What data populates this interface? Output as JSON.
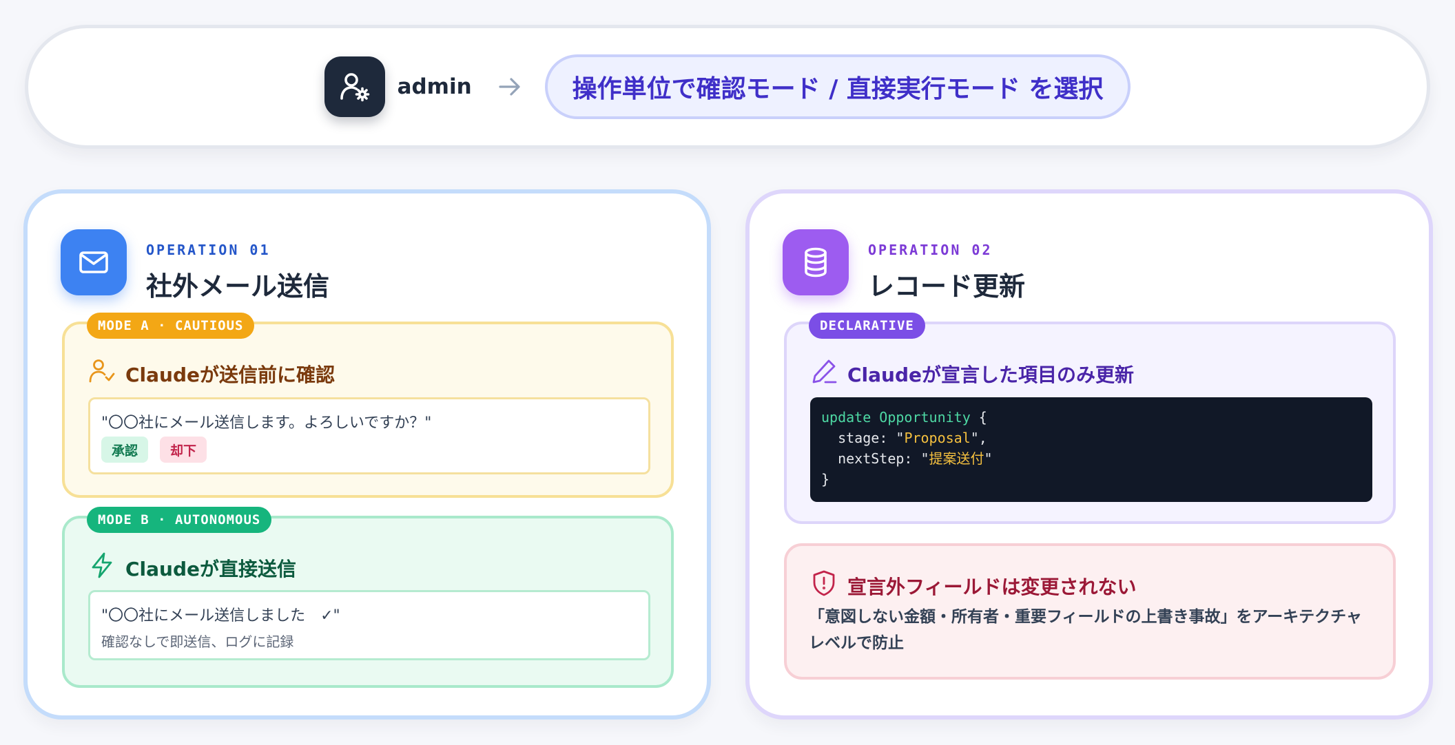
{
  "header": {
    "actor_label": "admin",
    "actor_icon": "user-gear-icon",
    "arrow_icon": "arrow-right-icon",
    "mode_pill": "操作単位で確認モード / 直接実行モード を選択"
  },
  "operations": [
    {
      "eyebrow": "OPERATION 01",
      "title": "社外メール送信",
      "icon": "mail-icon",
      "modes": [
        {
          "tag": "MODE A · CAUTIOUS",
          "icon": "user-check-icon",
          "heading": "Claudeが送信前に確認",
          "quote": "\"〇〇社にメール送信します。よろしいですか？\"",
          "approve_label": "承認",
          "reject_label": "却下"
        },
        {
          "tag": "MODE B · AUTONOMOUS",
          "icon": "lightning-icon",
          "heading": "Claudeが直接送信",
          "quote": "\"〇〇社にメール送信しました　✓\"",
          "note": "確認なしで即送信、ログに記録"
        }
      ]
    },
    {
      "eyebrow": "OPERATION 02",
      "title": "レコード更新",
      "icon": "database-icon",
      "declarative": {
        "tag": "DECLARATIVE",
        "icon": "pencil-icon",
        "heading": "Claudeが宣言した項目のみ更新",
        "code": {
          "keyword": "update",
          "object": "Opportunity",
          "fields": [
            {
              "name": "stage",
              "value": "Proposal"
            },
            {
              "name": "nextStep",
              "value": "提案送付"
            }
          ]
        }
      },
      "guard": {
        "icon": "shield-alert-icon",
        "heading": "宣言外フィールドは変更されない",
        "text": "「意図しない金額・所有者・重要フィールドの上書き事故」をアーキテクチャレベルで防止"
      }
    }
  ],
  "colors": {
    "blue": "#3d82f2",
    "violet": "#9d5cf0",
    "amber": "#f3a715",
    "emerald": "#16b57d",
    "purple": "#7b4ee6",
    "rose": "#9b1836",
    "dark": "#1e293b"
  }
}
